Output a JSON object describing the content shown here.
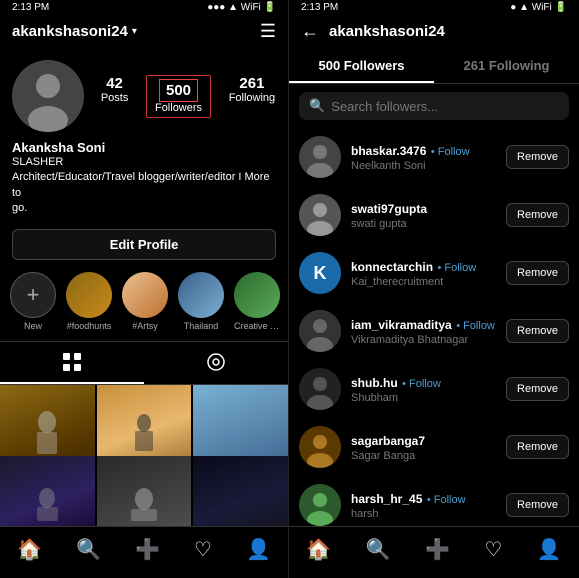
{
  "left": {
    "status_bar": {
      "time": "2:13 PM"
    },
    "header": {
      "username": "akankshasoni24",
      "chevron": "▾"
    },
    "stats": {
      "posts": {
        "number": "42",
        "label": "Posts"
      },
      "followers": {
        "number": "500",
        "label": "Followers"
      },
      "following": {
        "number": "261",
        "label": "Following"
      }
    },
    "profile": {
      "display_name": "Akanksha Soni",
      "bio_line1": "SLASHER",
      "bio_line2": "Architect/Educator/Travel blogger/writer/editor I More to",
      "bio_line3": "go."
    },
    "edit_profile_label": "Edit Profile",
    "stories": [
      {
        "label": "New",
        "type": "new"
      },
      {
        "label": "#foodhunts",
        "type": "img",
        "class": "story-img-1"
      },
      {
        "label": "#Artsy",
        "type": "img",
        "class": "story-img-2"
      },
      {
        "label": "Thailand",
        "type": "img",
        "class": "story-img-3"
      },
      {
        "label": "Creative W...",
        "type": "img",
        "class": "story-img-4"
      }
    ],
    "bottom_nav": [
      "🏠",
      "🔍",
      "➕",
      "♡",
      "👤"
    ]
  },
  "right": {
    "status_bar": {
      "time": "2:13 PM"
    },
    "header": {
      "back_label": "←",
      "username": "akankshasoni24"
    },
    "tabs": [
      {
        "label": "500 Followers",
        "active": true
      },
      {
        "label": "261 Following",
        "active": false
      }
    ],
    "search_placeholder": "Search followers...",
    "followers": [
      {
        "username": "bhaskar.3476",
        "follow": "• Follow",
        "real_name": "Neelkanth Soni",
        "av_class": "av1"
      },
      {
        "username": "swati97gupta",
        "follow": "",
        "real_name": "swati gupta",
        "av_class": "av2"
      },
      {
        "username": "konnectarchin",
        "follow": "• Follow",
        "real_name": "Kai_therecruitment",
        "av_class": "av3"
      },
      {
        "username": "iam_vikramaditya",
        "follow": "• Follow",
        "real_name": "Vikramaditya Bhatnagar",
        "av_class": "av4"
      },
      {
        "username": "shub.hu",
        "follow": "• Follow",
        "real_name": "Shubham",
        "av_class": "av5"
      },
      {
        "username": "sagarbanga7",
        "follow": "",
        "real_name": "Sagar Banga",
        "av_class": "av6"
      },
      {
        "username": "harsh_hr_45",
        "follow": "• Follow",
        "real_name": "harsh",
        "av_class": "av7"
      }
    ],
    "remove_label": "Remove",
    "bottom_nav": [
      "🏠",
      "🔍",
      "➕",
      "♡",
      "👤"
    ]
  }
}
